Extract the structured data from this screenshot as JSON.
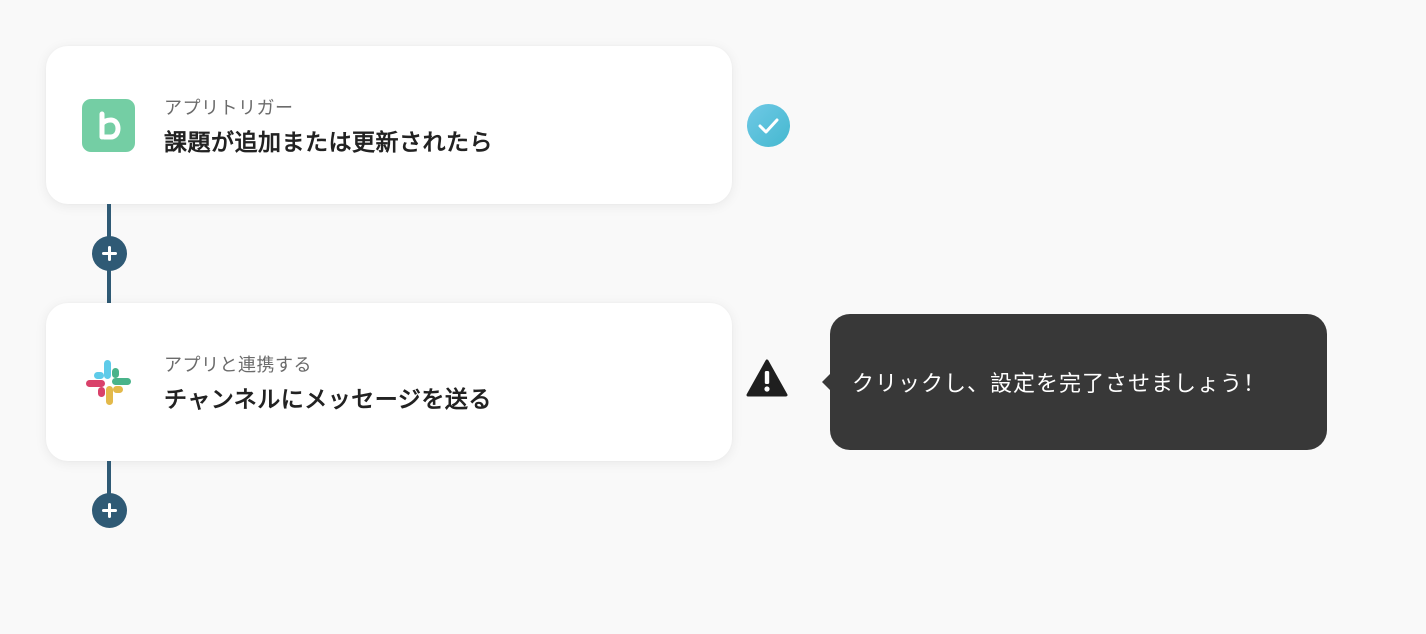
{
  "flow": {
    "trigger": {
      "app_icon": "backlog-icon",
      "sublabel": "アプリトリガー",
      "title": "課題が追加または更新されたら",
      "status": "complete",
      "status_icon": "check-circle-icon",
      "status_color": "#4fbdd6"
    },
    "action": {
      "app_icon": "slack-icon",
      "sublabel": "アプリと連携する",
      "title": "チャンネルにメッセージを送る",
      "status": "warning",
      "status_icon": "warning-triangle-icon"
    },
    "tooltip": {
      "text": "クリックし、設定を完了させましょう！"
    },
    "add_step_icon": "plus-icon"
  },
  "colors": {
    "background": "#f9f9f9",
    "card": "#ffffff",
    "connector": "#2f5a75",
    "backlog_green": "#74cea4",
    "tooltip_bg": "#383838",
    "check_blue": "#4fbdd6"
  }
}
